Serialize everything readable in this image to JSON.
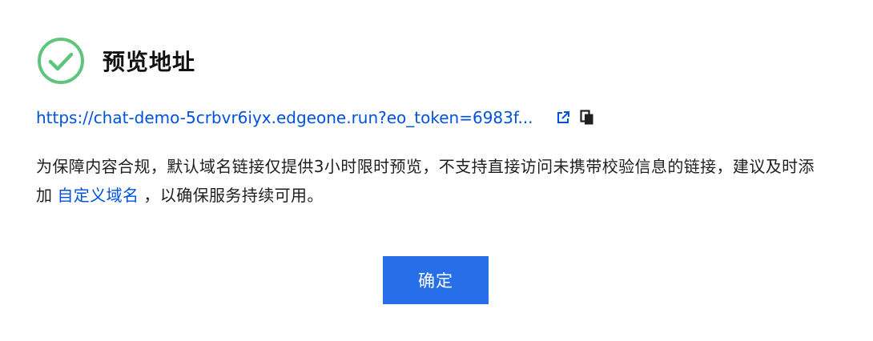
{
  "dialog": {
    "title": "预览地址",
    "icon": "check-circle-icon",
    "success_color": "#5ec57a",
    "preview_url": "https://chat-demo-5crbvr6iyx.edgeone.run?eo_token=6983f...",
    "open_icon": "external-link-icon",
    "copy_icon": "copy-icon",
    "notice_part1": "为保障内容合规，默认域名链接仅提供3小时限时预览，不支持直接访问未携带校验信息的链接，建议及时添加",
    "notice_link": "自定义域名",
    "notice_part2": "，以确保服务持续可用。",
    "link_color": "#0052d9",
    "confirm_label": "确定",
    "button_color": "#266fe8"
  }
}
